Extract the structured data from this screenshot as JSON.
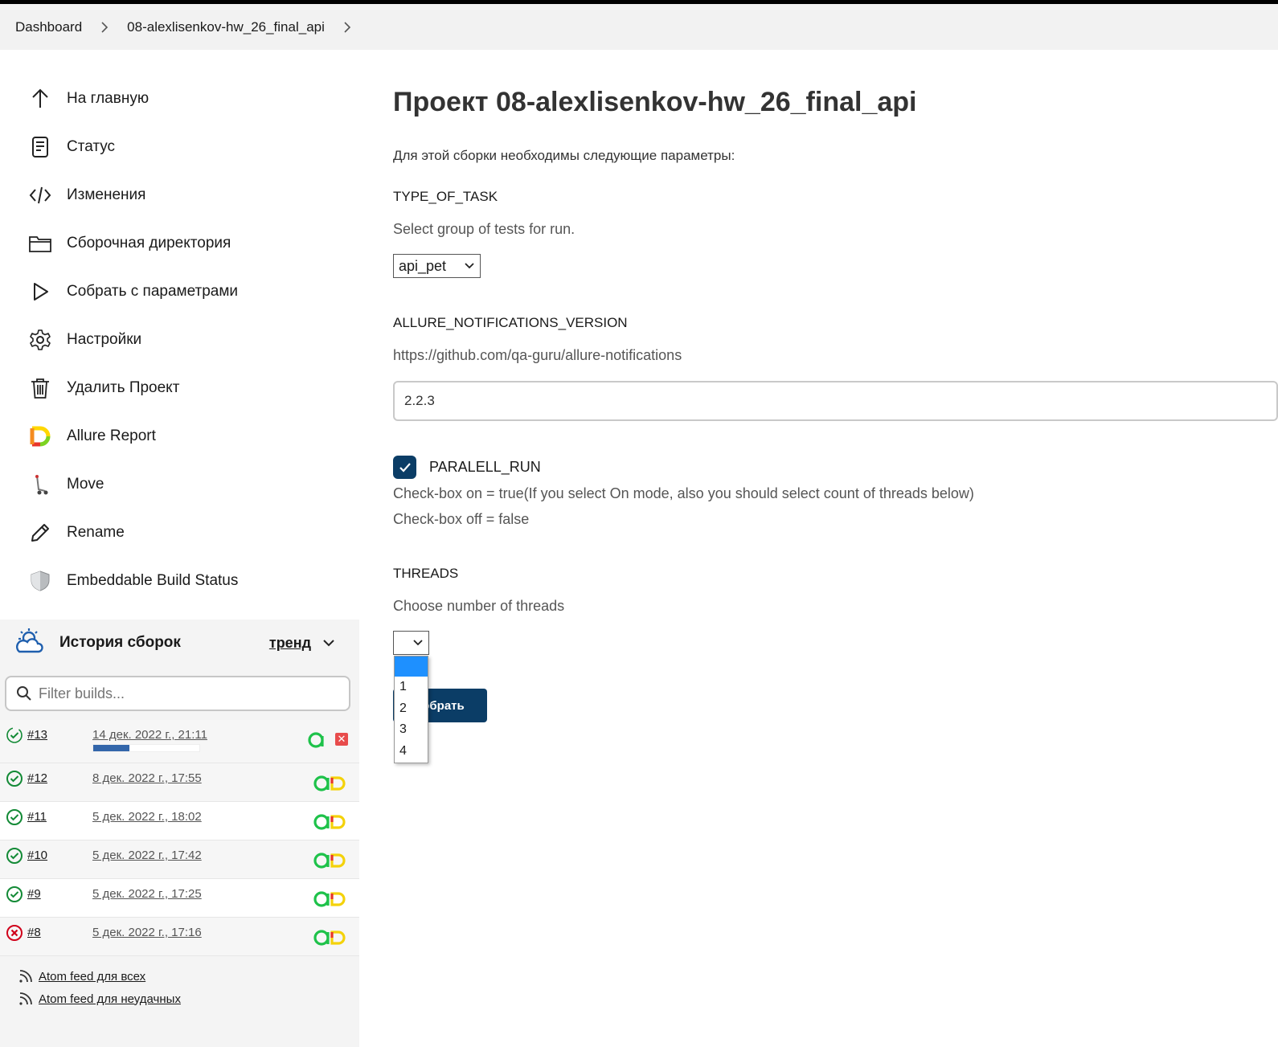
{
  "breadcrumb": {
    "dashboard": "Dashboard",
    "project": "08-alexlisenkov-hw_26_final_api"
  },
  "sidebar": {
    "items": [
      {
        "label": "На главную",
        "icon": "arrow-up-icon"
      },
      {
        "label": "Статус",
        "icon": "document-icon"
      },
      {
        "label": "Изменения",
        "icon": "code-icon"
      },
      {
        "label": "Сборочная директория",
        "icon": "folder-icon"
      },
      {
        "label": "Собрать с параметрами",
        "icon": "play-icon"
      },
      {
        "label": "Настройки",
        "icon": "gear-icon"
      },
      {
        "label": "Удалить Проект",
        "icon": "trash-icon"
      },
      {
        "label": "Allure Report",
        "icon": "allure-icon"
      },
      {
        "label": "Move",
        "icon": "move-icon"
      },
      {
        "label": "Rename",
        "icon": "pencil-icon"
      },
      {
        "label": "Embeddable Build Status",
        "icon": "shield-icon"
      }
    ]
  },
  "history": {
    "title": "История сборок",
    "trend": "тренд",
    "filter_placeholder": "Filter builds...",
    "builds": [
      {
        "num": "#13",
        "date": "14 дек. 2022 г., 21:11",
        "status": "running",
        "progress": 0.34
      },
      {
        "num": "#12",
        "date": "8 дек. 2022 г., 17:55",
        "status": "success"
      },
      {
        "num": "#11",
        "date": "5 дек. 2022 г., 18:02",
        "status": "success"
      },
      {
        "num": "#10",
        "date": "5 дек. 2022 г., 17:42",
        "status": "success"
      },
      {
        "num": "#9",
        "date": "5 дек. 2022 г., 17:25",
        "status": "success"
      },
      {
        "num": "#8",
        "date": "5 дек. 2022 г., 17:16",
        "status": "failed"
      }
    ],
    "feeds": {
      "all": "Atom feed для всех",
      "failed": "Atom feed для неудачных"
    }
  },
  "main": {
    "title": "Проект 08-alexlisenkov-hw_26_final_api",
    "intro": "Для этой сборки необходимы следующие параметры:",
    "type_of_task": {
      "name": "TYPE_OF_TASK",
      "desc": "Select group of tests for run.",
      "value": "api_pet"
    },
    "allure": {
      "name": "ALLURE_NOTIFICATIONS_VERSION",
      "desc": "https://github.com/qa-guru/allure-notifications",
      "value": "2.2.3"
    },
    "paralell": {
      "name": "PARALELL_RUN",
      "checked": true,
      "desc1": "Check-box on = true(If you select On mode, also you should select count of threads below)",
      "desc2": "Check-box off = false"
    },
    "threads": {
      "name": "THREADS",
      "desc": "Choose number of threads",
      "value": "",
      "options": [
        "",
        "1",
        "2",
        "3",
        "4"
      ]
    },
    "build_button": "обрать"
  },
  "colors": {
    "accent": "#0b3d66",
    "success": "#138a36",
    "failed": "#d0021b",
    "dropdown_selected": "#1e90ff"
  }
}
